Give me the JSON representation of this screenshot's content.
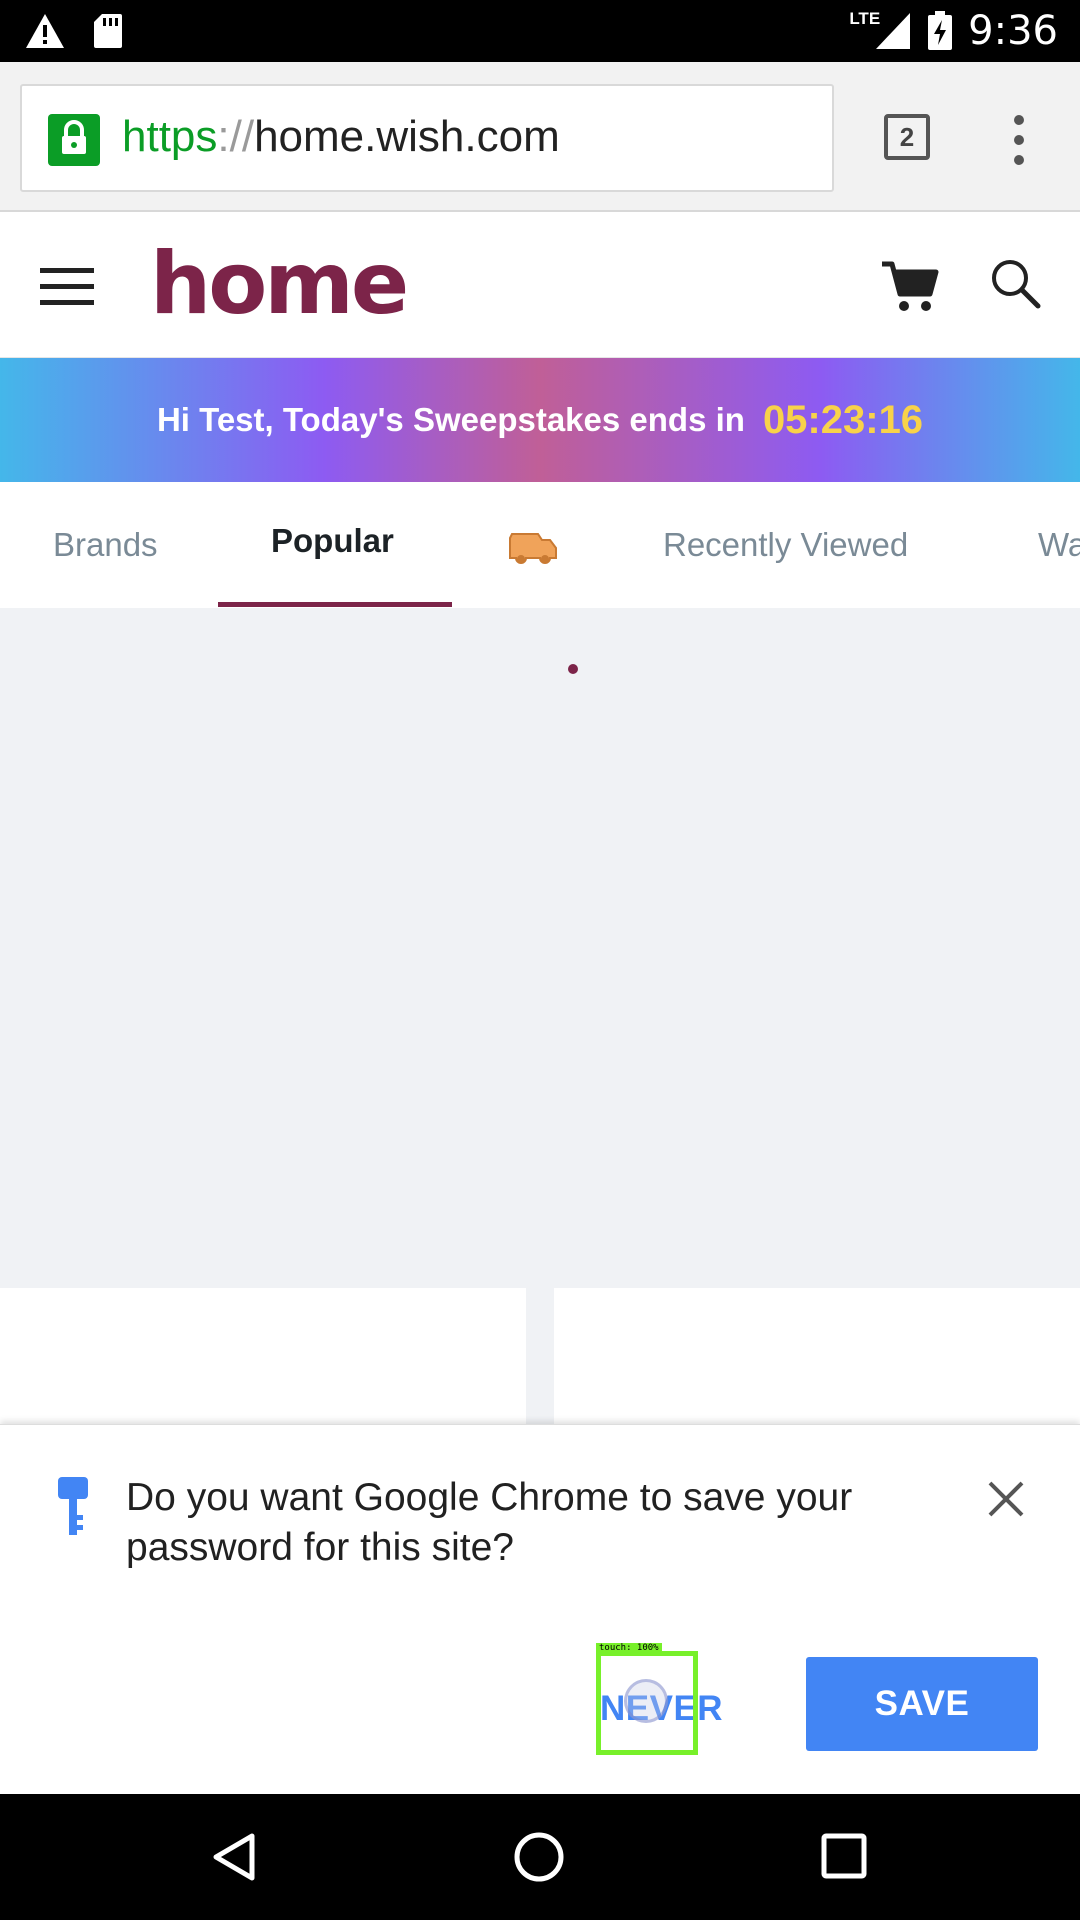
{
  "status_bar": {
    "time": "9:36",
    "network": "LTE",
    "icons": [
      "warning-icon",
      "sd-card-icon",
      "signal-icon",
      "battery-charging-icon"
    ]
  },
  "browser": {
    "url_scheme": "https",
    "url_separator": "://",
    "url_host": "home.wish.com",
    "tab_count": "2",
    "icons": [
      "lock-icon",
      "tab-switcher-icon",
      "overflow-menu-icon"
    ]
  },
  "site_header": {
    "logo": "home",
    "brand_color": "#7c2449",
    "icons": [
      "hamburger-menu-icon",
      "cart-icon",
      "search-icon"
    ]
  },
  "banner": {
    "message": "Hi Test, Today's Sweepstakes ends in",
    "timer": "05:23:16",
    "timer_color": "#f8d24a"
  },
  "tabs": {
    "items": [
      {
        "label": "Brands",
        "active": false
      },
      {
        "label": "Popular",
        "active": true
      },
      {
        "label": "",
        "icon": "truck-icon",
        "active": false
      },
      {
        "label": "Recently Viewed",
        "active": false
      },
      {
        "label": "Wa",
        "active": false
      }
    ]
  },
  "password_prompt": {
    "message": "Do you want Google Chrome to save your password for this site?",
    "never_label": "NEVER",
    "save_label": "SAVE",
    "accent_color": "#4285f4",
    "touch_overlay_label": "touch: 100%"
  },
  "nav_bar": {
    "icons": [
      "back-icon",
      "home-icon",
      "recents-icon"
    ]
  }
}
